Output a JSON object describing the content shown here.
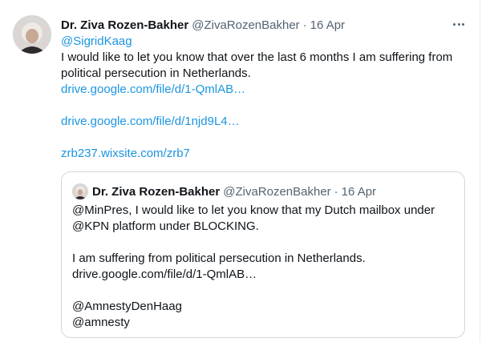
{
  "tweet": {
    "author_name": "Dr. Ziva Rozen-Bakher",
    "author_handle": "@ZivaRozenBakher",
    "separator": "·",
    "date": "16 Apr",
    "mention": "@SigridKaag",
    "text_line1": "I would like to let you know that over the last 6 months  I am suffering from",
    "text_line2": "political persecution in Netherlands.",
    "link1": "drive.google.com/file/d/1-QmlAB…",
    "link2": "drive.google.com/file/d/1njd9L4…",
    "link3": "zrb237.wixsite.com/zrb7",
    "more_icon": "more-horizontal-icon"
  },
  "quoted_tweet": {
    "author_name": "Dr. Ziva Rozen-Bakher",
    "author_handle": "@ZivaRozenBakher",
    "separator": "·",
    "date": "16 Apr",
    "line1": "@MinPres, I would like to let you know that my Dutch mailbox under",
    "line2": "@KPN platform under BLOCKING.",
    "line3": "I am suffering from political persecution in Netherlands.",
    "line4": "drive.google.com/file/d/1-QmlAB…",
    "line5": "@AmnestyDenHaag",
    "line6": "@amnesty"
  },
  "colors": {
    "link": "#1b95e0",
    "secondary_text": "#536471",
    "border": "#cfd9de"
  }
}
